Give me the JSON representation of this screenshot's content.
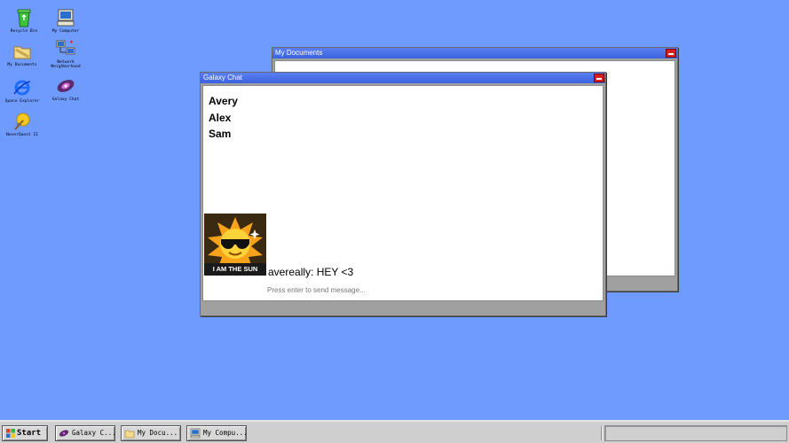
{
  "desktop": {
    "icons": [
      {
        "label": "Recycle Bin"
      },
      {
        "label": "My Computer"
      },
      {
        "label": "My Documents"
      },
      {
        "label": "Network\nNeighborhood"
      },
      {
        "label": "Space Explorer"
      },
      {
        "label": "Galaxy Chat"
      },
      {
        "label": "NeverQuest II"
      }
    ]
  },
  "windows": {
    "documents": {
      "title": "My Documents"
    },
    "chat": {
      "title": "Galaxy Chat",
      "users": [
        "Avery",
        "Alex",
        "Sam"
      ],
      "avatar_caption": "I AM THE SUN",
      "message": "avereally: HEY <3",
      "input_placeholder": "Press enter to send message..."
    }
  },
  "taskbar": {
    "start_label": "Start",
    "buttons": [
      {
        "label": "Galaxy C..."
      },
      {
        "label": "My Docu..."
      },
      {
        "label": "My Compu..."
      }
    ]
  },
  "colors": {
    "desktop": "#6f9bff",
    "titlebar": "#3a62e0",
    "close": "#d81e1e"
  }
}
